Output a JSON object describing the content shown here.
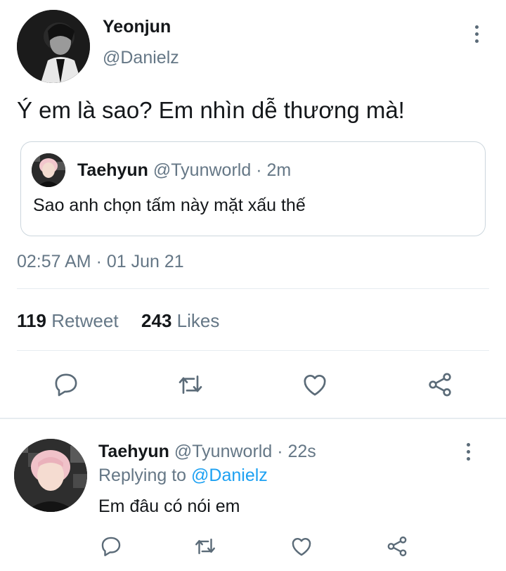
{
  "main_tweet": {
    "display_name": "Yeonjun",
    "handle": "@Danielz",
    "text": "Ý em là sao? Em nhìn dễ thương mà!",
    "quoted": {
      "display_name": "Taehyun",
      "handle": "@Tyunworld",
      "time": "· 2m",
      "text": "Sao anh chọn tấm này mặt xấu thế"
    },
    "timestamp": "02:57 AM · 01 Jun 21",
    "retweet_count": "119",
    "retweet_label": "Retweet",
    "likes_count": "243",
    "likes_label": "Likes"
  },
  "reply": {
    "display_name": "Taehyun",
    "handle": "@Tyunworld",
    "time": "· 22s",
    "replying_prefix": "Replying to",
    "replying_handle": "@Danielz",
    "text": "Em đâu có nói em"
  },
  "icons": {
    "reply": "reply-icon",
    "retweet": "retweet-icon",
    "like": "heart-icon",
    "share": "share-icon",
    "more": "more-vertical-icon"
  },
  "colors": {
    "link": "#1da1f2",
    "muted": "#657786",
    "icon": "#5b6b78"
  }
}
